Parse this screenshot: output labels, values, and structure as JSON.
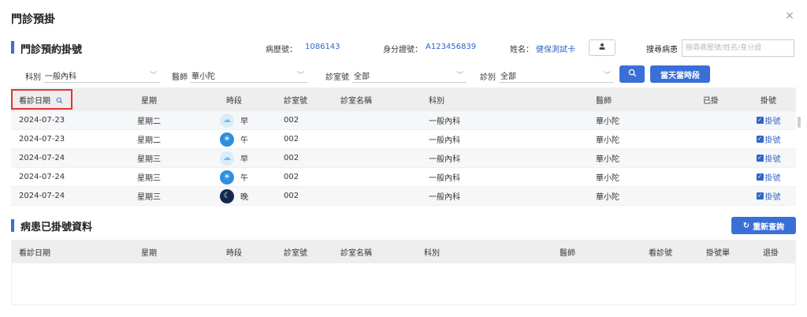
{
  "window": {
    "title": "門診預掛",
    "close_glyph": "×"
  },
  "section1": {
    "title": "門診預約掛號"
  },
  "patient": {
    "chart_label": "病歷號：",
    "chart_no": "1086143",
    "id_label": "身分證號：",
    "id_no": "A123456839",
    "name_label": "姓名：",
    "name": "健保測試卡",
    "search_label": "搜尋病患",
    "search_placeholder": "搜尋病歷號/姓名/身分證"
  },
  "filters": {
    "dept_label": "科別",
    "dept_value": "一般內科",
    "doctor_label": "醫師",
    "doctor_value": "華小陀",
    "room_label": "診室號",
    "room_value": "全部",
    "type_label": "診別",
    "type_value": "全部",
    "today_button": "當天當時段"
  },
  "table1": {
    "headers": [
      "看診日期",
      "星期",
      "時段",
      "診室號",
      "診室名稱",
      "科別",
      "醫師",
      "已掛",
      "掛號"
    ],
    "rows": [
      {
        "date": "2024-07-23",
        "weekday": "星期二",
        "period": "早",
        "period_icon": "morning",
        "room": "002",
        "room_name": "",
        "dept": "一般內科",
        "doctor": "華小陀",
        "booked": "",
        "action": "掛號"
      },
      {
        "date": "2024-07-23",
        "weekday": "星期二",
        "period": "午",
        "period_icon": "noon",
        "room": "002",
        "room_name": "",
        "dept": "一般內科",
        "doctor": "華小陀",
        "booked": "",
        "action": "掛號"
      },
      {
        "date": "2024-07-24",
        "weekday": "星期三",
        "period": "早",
        "period_icon": "morning",
        "room": "002",
        "room_name": "",
        "dept": "一般內科",
        "doctor": "華小陀",
        "booked": "",
        "action": "掛號"
      },
      {
        "date": "2024-07-24",
        "weekday": "星期三",
        "period": "午",
        "period_icon": "noon",
        "room": "002",
        "room_name": "",
        "dept": "一般內科",
        "doctor": "華小陀",
        "booked": "",
        "action": "掛號"
      },
      {
        "date": "2024-07-24",
        "weekday": "星期三",
        "period": "晚",
        "period_icon": "night",
        "room": "002",
        "room_name": "",
        "dept": "一般內科",
        "doctor": "華小陀",
        "booked": "",
        "action": "掛號"
      }
    ]
  },
  "section2": {
    "title": "病患已掛號資料",
    "refresh_button": "重新查詢"
  },
  "table2": {
    "headers": [
      "看診日期",
      "星期",
      "時段",
      "診室號",
      "診室名稱",
      "科別",
      "醫師",
      "看診號",
      "掛號單",
      "退掛"
    ]
  },
  "colors": {
    "accent": "#3a6fd8",
    "link": "#2f66c8",
    "highlight": "#e53333"
  }
}
